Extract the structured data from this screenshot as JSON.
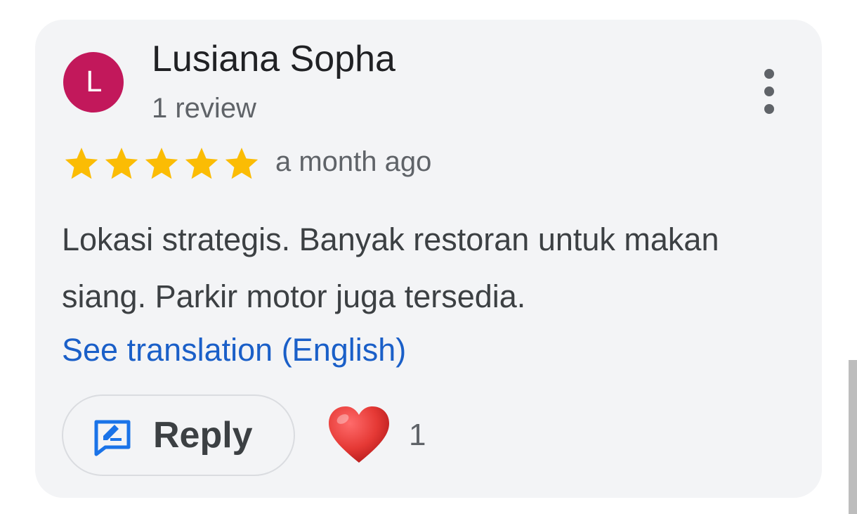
{
  "review": {
    "author_initial": "L",
    "author_name": "Lusiana Sopha",
    "review_count": "1 review",
    "rating": 5,
    "rating_max": 5,
    "time": "a month ago",
    "text": "Lokasi strategis. Banyak restoran untuk makan siang. Parkir motor juga tersedia.",
    "translate_link": "See translation (English)",
    "reply_label": "Reply",
    "like_count": "1"
  },
  "icons": {
    "menu": "more-vert-icon",
    "star": "star-icon",
    "reply": "reply-edit-icon",
    "like": "heart-icon"
  },
  "colors": {
    "avatar": "#c2185b",
    "star": "#fbbc04",
    "link": "#1a5fc8",
    "heart": "#e53935",
    "reply_icon": "#1a73e8"
  }
}
